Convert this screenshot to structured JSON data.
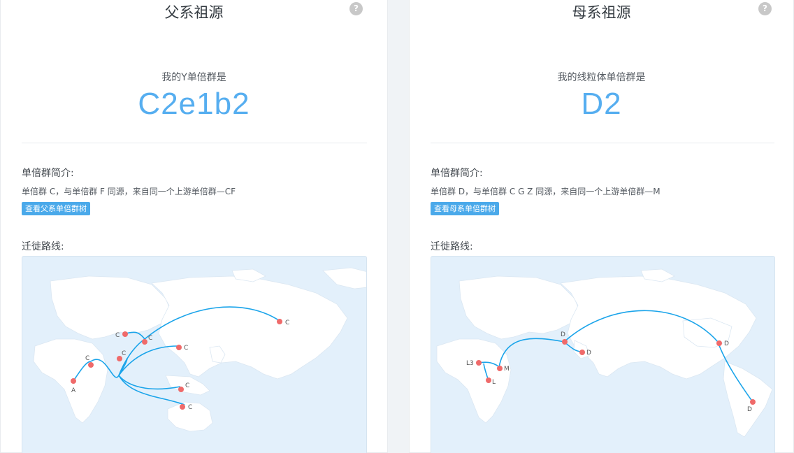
{
  "paternal": {
    "title": "父系祖源",
    "help": "?",
    "haplogroup_label": "我的Y单倍群是",
    "haplogroup_value": "C2e1b2",
    "intro_title": "单倍群简介:",
    "intro_text": "单倍群 C，与单倍群 F 同源，来自同一个上游单倍群—CF",
    "tree_button": "查看父系单倍群树",
    "route_title": "迁徙路线:",
    "map_points": [
      "A",
      "C",
      "C",
      "C",
      "C",
      "C",
      "C",
      "C",
      "C"
    ]
  },
  "maternal": {
    "title": "母系祖源",
    "help": "?",
    "haplogroup_label": "我的线粒体单倍群是",
    "haplogroup_value": "D2",
    "intro_title": "单倍群简介:",
    "intro_text": "单倍群 D，与单倍群 C G Z 同源，来自同一个上游单倍群—M",
    "tree_button": "查看母系单倍群树",
    "route_title": "迁徙路线:",
    "map_points": [
      "L3",
      "M",
      "L",
      "D",
      "D",
      "D",
      "D"
    ]
  },
  "colors": {
    "accent": "#56aef0",
    "button": "#4aa9ea",
    "route": "#1aa4ea",
    "marker": "#ef6a6a"
  }
}
